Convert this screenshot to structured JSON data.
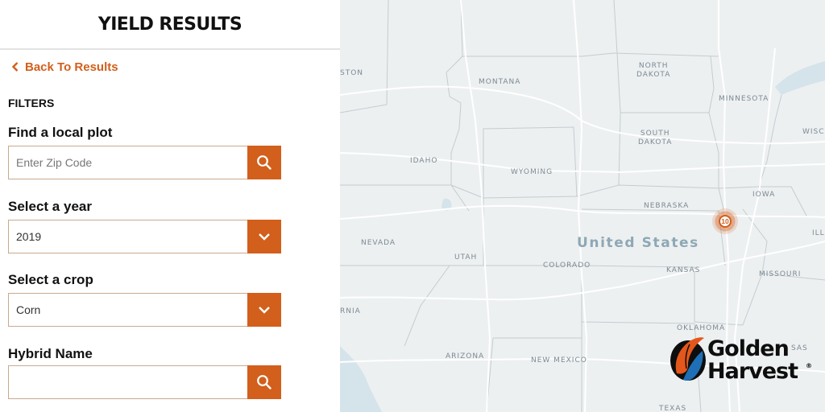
{
  "panel": {
    "title": "YIELD RESULTS",
    "back_link": "Back To Results",
    "filters_heading": "FILTERS",
    "local_plot": {
      "label": "Find a local plot",
      "placeholder": "Enter Zip Code",
      "value": ""
    },
    "year": {
      "label": "Select a year",
      "selected": "2019"
    },
    "crop": {
      "label": "Select a crop",
      "selected": "Corn"
    },
    "hybrid": {
      "label": "Hybrid Name",
      "placeholder": "",
      "value": ""
    }
  },
  "map": {
    "country": "United States",
    "labels": {
      "north_dakota": "NORTH\nDAKOTA",
      "montana": "MONTANA",
      "minnesota": "MINNESOTA",
      "south_dakota": "SOUTH\nDAKOTA",
      "idaho": "IDAHO",
      "wyoming": "WYOMING",
      "wisc": "WISC",
      "iowa": "IOWA",
      "nebraska": "NEBRASKA",
      "nevada": "NEVADA",
      "utah": "UTAH",
      "colorado": "COLORADO",
      "kansas": "KANSAS",
      "ill": "ILL",
      "missouri": "MISSOURI",
      "rnia": "RNIA",
      "oklahoma": "OKLAHOMA",
      "arizona": "ARIZONA",
      "new_mexico": "NEW MEXICO",
      "texas": "TEXAS",
      "ston": "STON",
      "sas": "SAS"
    },
    "cluster_count": "10"
  },
  "logo": {
    "line1": "Golden",
    "line2": "Harvest",
    "mark": "®"
  },
  "colors": {
    "accent": "#d25f1c",
    "map_bg": "#edf0f1",
    "water": "#d5e3ea"
  },
  "icons": {
    "back": "chevron-left-icon",
    "search": "search-icon",
    "dropdown": "chevron-down-icon"
  }
}
